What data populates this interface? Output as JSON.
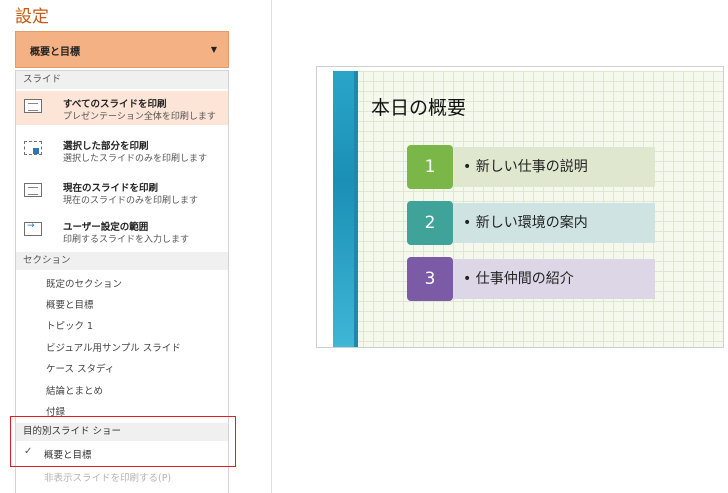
{
  "settings": {
    "title": "設定",
    "dropdown_value": "概要と目標",
    "slides_header": "スライド",
    "options": [
      {
        "title": "すべてのスライドを印刷",
        "desc": "プレゼンテーション全体を印刷します",
        "icon": "all-slides-icon"
      },
      {
        "title": "選択した部分を印刷",
        "desc": "選択したスライドのみを印刷します",
        "icon": "selection-icon"
      },
      {
        "title": "現在のスライドを印刷",
        "desc": "現在のスライドのみを印刷します",
        "icon": "current-slide-icon"
      },
      {
        "title": "ユーザー設定の範囲",
        "desc": "印刷するスライドを入力します",
        "icon": "custom-range-icon"
      }
    ],
    "sections_header": "セクション",
    "sections": [
      "既定のセクション",
      "概要と目標",
      "トピック 1",
      "ビジュアル用サンプル スライド",
      "ケース スタディ",
      "結論とまとめ",
      "付録"
    ],
    "custom_show_header": "目的別スライド ショー",
    "custom_show_item": "概要と目標",
    "hidden_slides_option": "非表示スライドを印刷する(P)"
  },
  "preview": {
    "slide_title": "本日の概要",
    "items": [
      {
        "num": "1",
        "text": "• 新しい仕事の説明",
        "num_color": "#7ab648",
        "bg": "#dfe8cf"
      },
      {
        "num": "2",
        "text": "• 新しい環境の案内",
        "num_color": "#3fa39a",
        "bg": "#cfe4e2"
      },
      {
        "num": "3",
        "text": "• 仕事仲間の紹介",
        "num_color": "#7b5aa6",
        "bg": "#ddd6e6"
      }
    ]
  },
  "colors": {
    "accent": "#c55a11",
    "dropdown_bg": "#f4b183",
    "highlight_box": "#e02020"
  }
}
